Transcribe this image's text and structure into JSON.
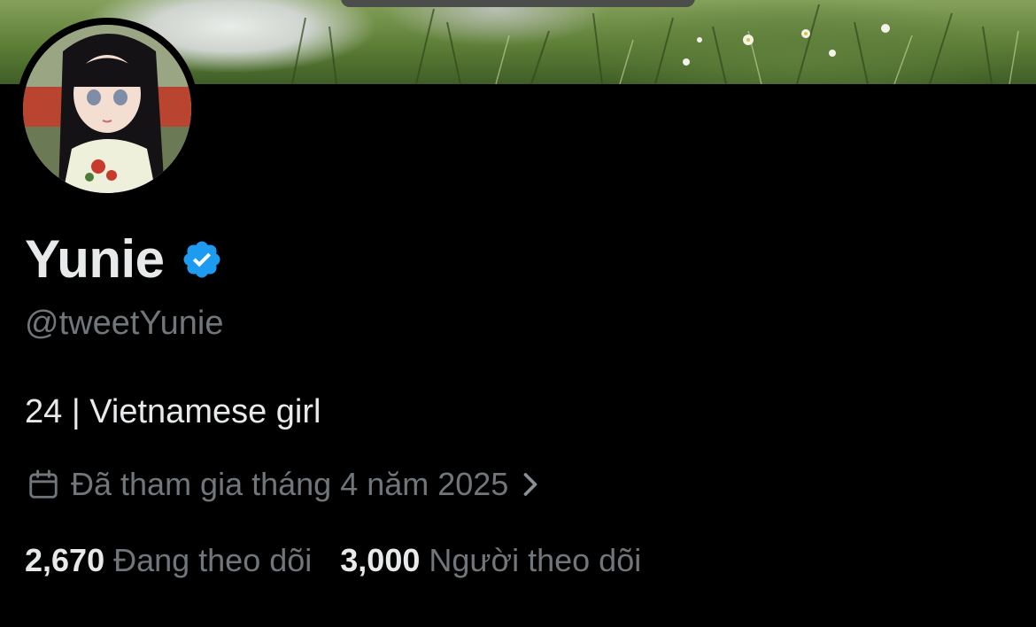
{
  "profile": {
    "display_name": "Yunie",
    "handle": "@tweetYunie",
    "verified_icon": "verified-badge-icon",
    "bio": "24 | Vietnamese girl",
    "joined_icon": "calendar-icon",
    "joined_text": "Đã tham gia tháng 4 năm 2025",
    "joined_chevron_icon": "chevron-right-icon",
    "following_count": "2,670",
    "following_label": "Đang theo dõi",
    "followers_count": "3,000",
    "followers_label": "Người theo dõi"
  },
  "colors": {
    "background": "#000000",
    "primary_text": "#e7e9ea",
    "secondary_text": "#71767b",
    "verified": "#1d9bf0"
  }
}
